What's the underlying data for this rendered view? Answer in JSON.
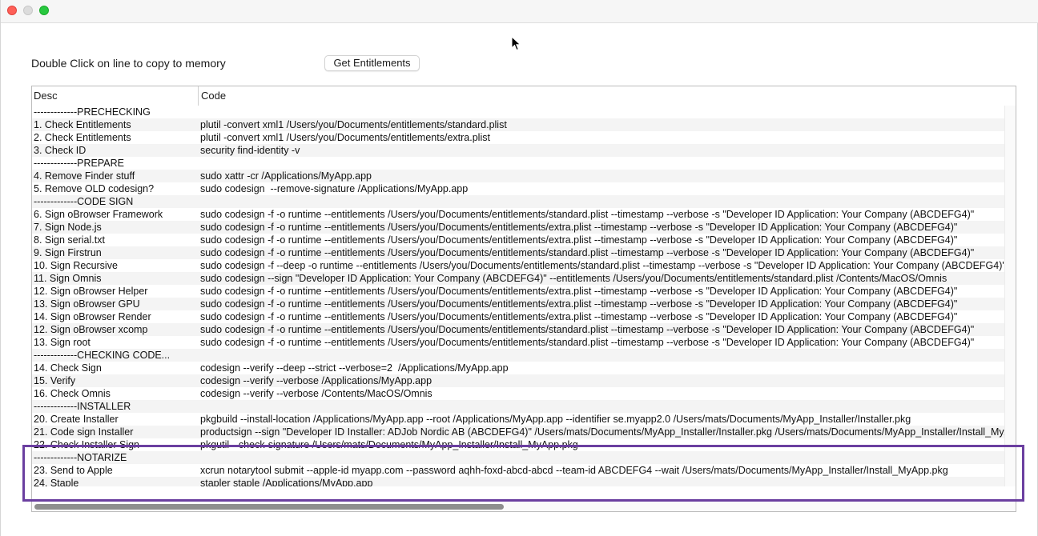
{
  "instruction": "Double Click on line to copy to memory",
  "get_button_label": "Get Entitlements",
  "table": {
    "headers": {
      "desc": "Desc",
      "code": "Code"
    },
    "rows": [
      {
        "desc": "-------------PRECHECKING",
        "code": ""
      },
      {
        "desc": "1. Check Entitlements",
        "code": "plutil -convert xml1 /Users/you/Documents/entitlements/standard.plist"
      },
      {
        "desc": "2. Check Entitlements",
        "code": "plutil -convert xml1 /Users/you/Documents/entitlements/extra.plist"
      },
      {
        "desc": "3. Check ID",
        "code": "security find-identity -v"
      },
      {
        "desc": "-------------PREPARE",
        "code": ""
      },
      {
        "desc": "4. Remove Finder stuff",
        "code": "sudo xattr -cr /Applications/MyApp.app"
      },
      {
        "desc": "5. Remove OLD codesign?",
        "code": "sudo codesign  --remove-signature /Applications/MyApp.app"
      },
      {
        "desc": "-------------CODE SIGN",
        "code": ""
      },
      {
        "desc": "6. Sign oBrowser Framework",
        "code": "sudo codesign -f -o runtime --entitlements /Users/you/Documents/entitlements/standard.plist --timestamp --verbose -s \"Developer ID Application: Your Company (ABCDEFG4)\""
      },
      {
        "desc": "7. Sign Node.js",
        "code": "sudo codesign -f -o runtime --entitlements /Users/you/Documents/entitlements/extra.plist --timestamp --verbose -s \"Developer ID Application: Your Company (ABCDEFG4)\""
      },
      {
        "desc": "8. Sign serial.txt",
        "code": "sudo codesign -f -o runtime --entitlements /Users/you/Documents/entitlements/extra.plist --timestamp --verbose -s \"Developer ID Application: Your Company (ABCDEFG4)\""
      },
      {
        "desc": "9. Sign Firstrun",
        "code": "sudo codesign -f -o runtime --entitlements /Users/you/Documents/entitlements/standard.plist --timestamp --verbose -s \"Developer ID Application: Your Company (ABCDEFG4)\""
      },
      {
        "desc": "10. Sign Recursive",
        "code": "sudo codesign -f --deep -o runtime --entitlements /Users/you/Documents/entitlements/standard.plist --timestamp --verbose -s \"Developer ID Application: Your Company (ABCDEFG4)\""
      },
      {
        "desc": "11. Sign Omnis",
        "code": "sudo codesign --sign \"Developer ID Application: Your Company (ABCDEFG4)\" --entitlements /Users/you/Documents/entitlements/standard.plist /Contents/MacOS/Omnis"
      },
      {
        "desc": "12. Sign oBrowser Helper",
        "code": "sudo codesign -f -o runtime --entitlements /Users/you/Documents/entitlements/extra.plist --timestamp --verbose -s \"Developer ID Application: Your Company (ABCDEFG4)\""
      },
      {
        "desc": "13. Sign oBrowser GPU",
        "code": "sudo codesign -f -o runtime --entitlements /Users/you/Documents/entitlements/extra.plist --timestamp --verbose -s \"Developer ID Application: Your Company (ABCDEFG4)\""
      },
      {
        "desc": "14. Sign oBrowser Render",
        "code": "sudo codesign -f -o runtime --entitlements /Users/you/Documents/entitlements/extra.plist --timestamp --verbose -s \"Developer ID Application: Your Company (ABCDEFG4)\""
      },
      {
        "desc": "12. Sign oBrowser xcomp",
        "code": "sudo codesign -f -o runtime --entitlements /Users/you/Documents/entitlements/standard.plist --timestamp --verbose -s \"Developer ID Application: Your Company (ABCDEFG4)\""
      },
      {
        "desc": "13. Sign root",
        "code": "sudo codesign -f -o runtime --entitlements /Users/you/Documents/entitlements/standard.plist --timestamp --verbose -s \"Developer ID Application: Your Company (ABCDEFG4)\""
      },
      {
        "desc": "-------------CHECKING CODE...",
        "code": ""
      },
      {
        "desc": "14. Check Sign",
        "code": "codesign --verify --deep --strict --verbose=2  /Applications/MyApp.app"
      },
      {
        "desc": "15. Verify",
        "code": "codesign --verify --verbose /Applications/MyApp.app"
      },
      {
        "desc": "16. Check Omnis",
        "code": "codesign --verify --verbose /Contents/MacOS/Omnis"
      },
      {
        "desc": "-------------INSTALLER",
        "code": ""
      },
      {
        "desc": "20. Create Installer",
        "code": "pkgbuild --install-location /Applications/MyApp.app --root /Applications/MyApp.app --identifier se.myapp2.0 /Users/mats/Documents/MyApp_Installer/Installer.pkg"
      },
      {
        "desc": "21. Code sign Installer",
        "code": "productsign --sign \"Developer ID Installer: ADJob Nordic AB (ABCDEFG4)\" /Users/mats/Documents/MyApp_Installer/Installer.pkg /Users/mats/Documents/MyApp_Installer/Install_MyApp.pkg"
      },
      {
        "desc": "22. Check Installer Sign",
        "code": "pkgutil --check-signature /Users/mats/Documents/MyApp_Installer/Install_MyApp.pkg"
      },
      {
        "desc": "-------------NOTARIZE",
        "code": ""
      },
      {
        "desc": "23. Send to Apple",
        "code": "xcrun notarytool submit --apple-id myapp.com --password aqhh-foxd-abcd-abcd --team-id ABCDEFG4 --wait /Users/mats/Documents/MyApp_Installer/Install_MyApp.pkg"
      },
      {
        "desc": "24. Staple",
        "code": "stapler staple /Applications/MyApp.app"
      }
    ]
  },
  "colors": {
    "highlight_border": "#6b3fa0",
    "row_alt": "#f4f4f4",
    "scroll_thumb": "#8e8e8e"
  }
}
